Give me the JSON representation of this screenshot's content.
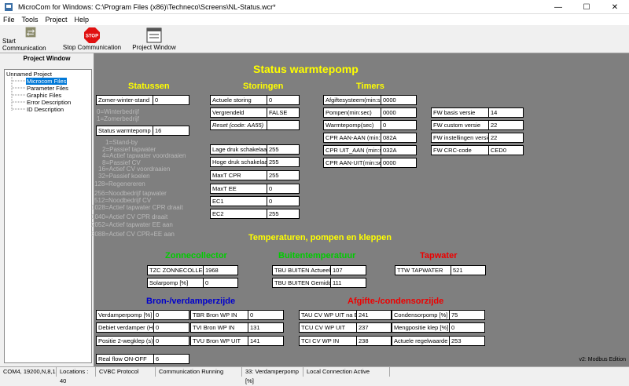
{
  "window": {
    "title": "MicroCom for Windows: C:\\Program Files (x86)\\Techneco\\Screens\\NL-Status.wcr*"
  },
  "menu": {
    "items": [
      "File",
      "Tools",
      "Project",
      "Help"
    ]
  },
  "toolbar": {
    "start": "Start Communication",
    "stop": "Stop Communication",
    "stop_icon_text": "STOP",
    "project": "Project Window"
  },
  "project_window": {
    "header": "Project Window",
    "tree": [
      "Unnamed Project",
      "Microcom Files",
      "Parameter Files",
      "Graphic Files",
      "Error Description",
      "ID Description"
    ]
  },
  "main": {
    "title": "Status warmtepomp",
    "statussen": {
      "heading": "Statussen",
      "zomer": {
        "label": "Zomer-winter-stand",
        "value": "0"
      },
      "zomer_legend": [
        "0=Winterbedrijf",
        "1=Zomerbedrijf"
      ],
      "status": {
        "label": "Status warmtepomp",
        "value": "16"
      },
      "status_legend": [
        "1=Stand-by",
        "2=Passief tapwater",
        "4=Actief tapwater voordraaien",
        "8=Passief CV",
        "16=Actief CV voordraaien",
        "32=Passief koelen",
        "128=Regenereren",
        "256=Noodbedrijf tapwater",
        "512=Noodbedrijf CV",
        "1028=Actief tapwater CPR draait",
        "1040=Actief CV CPR draait",
        "2052=Actief tapwater EE aan",
        "3088=Actief CV CPR+EE aan"
      ]
    },
    "storingen": {
      "heading": "Storingen",
      "rows": [
        {
          "label": "Actuele storing",
          "value": "0"
        },
        {
          "label": "Vergrendeld",
          "value": "FALSE"
        },
        {
          "label": "Reset (code: AA55)",
          "value": ""
        },
        {
          "label": "Lage druk schakelaar",
          "value": "255"
        },
        {
          "label": "Hoge druk schakelaar",
          "value": "255"
        },
        {
          "label": "MaxT CPR",
          "value": "255"
        },
        {
          "label": "MaxT EE",
          "value": "0"
        },
        {
          "label": "EC1",
          "value": "0"
        },
        {
          "label": "EC2",
          "value": "255"
        }
      ]
    },
    "timers": {
      "heading": "Timers",
      "rows": [
        {
          "label": "Afgiftesysteem(min:sec)",
          "value": "0000"
        },
        {
          "label": "Pompen(min:sec)",
          "value": "0000"
        },
        {
          "label": "Warmtepomp(sec)",
          "value": "0"
        },
        {
          "label": "CPR AAN-AAN (min:sec)",
          "value": "082A"
        },
        {
          "label": "CPR UIT_AAN (min:sec)",
          "value": "032A"
        },
        {
          "label": "CPR AAN-UIT(min:sec)",
          "value": "0000"
        }
      ]
    },
    "fw": {
      "rows": [
        {
          "label": "FW basis versie",
          "value": "14"
        },
        {
          "label": "FW custom versie",
          "value": "22"
        },
        {
          "label": "FW instellingen versie",
          "value": "22"
        },
        {
          "label": "FW CRC-code",
          "value": "CED0"
        }
      ]
    },
    "temps_heading": "Temperaturen, pompen en kleppen",
    "zonne": {
      "heading": "Zonnecollector",
      "rows": [
        {
          "label": "TZC ZONNECOLLECTOR",
          "value": "1968"
        },
        {
          "label": "Solarpomp [%]",
          "value": "0"
        }
      ]
    },
    "buiten": {
      "heading": "Buitentemperatuur",
      "rows": [
        {
          "label": "TBU BUITEN Actueel",
          "value": "107"
        },
        {
          "label": "TBU BUITEN Gemiddeld",
          "value": "111"
        }
      ]
    },
    "tapwater": {
      "heading": "Tapwater",
      "rows": [
        {
          "label": "TTW TAPWATER",
          "value": "521"
        }
      ]
    },
    "bron": {
      "heading": "Bron-/verdamperzijde",
      "left": [
        {
          "label": "Verdamperpomp [%]",
          "value": "0"
        },
        {
          "label": "Debiet verdamper (Hz)",
          "value": "0"
        },
        {
          "label": "Positie 2-wegklep (s)",
          "value": "0"
        }
      ],
      "right": [
        {
          "label": "TBR Bron WP IN",
          "value": "0"
        },
        {
          "label": "TVI Bron WP IN",
          "value": "131"
        },
        {
          "label": "TVU Bron WP UIT",
          "value": "141"
        }
      ],
      "realflow": {
        "label": "Real flow ON-OFF",
        "value": "6"
      }
    },
    "afgifte": {
      "heading": "Afgifte-/condensorzijde",
      "left": [
        {
          "label": "TAU CV WP UIT na EE",
          "value": "241"
        },
        {
          "label": "TCU CV WP UIT",
          "value": "237"
        },
        {
          "label": "TCI CV WP IN",
          "value": "238"
        }
      ],
      "right": [
        {
          "label": "Condensorpomp [%]",
          "value": "75"
        },
        {
          "label": "Mengpositie klep [%]",
          "value": "0"
        },
        {
          "label": "Actuele regelwaarde",
          "value": "253"
        }
      ]
    },
    "edition": "v2: Modbus Edition"
  },
  "statusbar": [
    "COM4, 19200,N,8,1",
    "Locations : 40",
    "CVBC Protocol",
    "Communication Running",
    "33: Verdamperpomp [%]",
    "Local Connection Active"
  ]
}
